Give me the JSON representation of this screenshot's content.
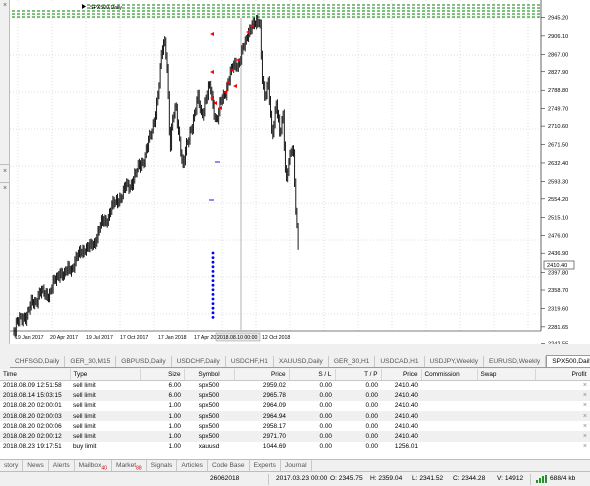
{
  "chart": {
    "symbol_label": "SPX500,Daily",
    "price_labels": [
      "2945.20",
      "2906.10",
      "2867.00",
      "2827.90",
      "2788.80",
      "2749.70",
      "2710.60",
      "2671.50",
      "2632.40",
      "2593.30",
      "2554.20",
      "2515.10",
      "2476.00",
      "2436.90",
      "2397.80",
      "2358.70",
      "2319.60",
      "2281.65",
      "2242.55"
    ],
    "current_price": "2410.40",
    "date_labels": [
      "19 Jan 2017",
      "20 Apr 2017",
      "19 Jul 2017",
      "17 Oct 2017",
      "17 Jan 2018",
      "17 Apr 2018",
      "2018.08.10 00:00",
      "12 Oct 2018"
    ],
    "colors": {
      "bar": "#000000",
      "grid": "#c0c0c0",
      "order_levels": "#008000",
      "sell_marker": "#ff0000",
      "buy_marker": "#0000ff"
    },
    "icons": [
      "close-icon",
      "arrow-icon"
    ]
  },
  "chart_tabs": [
    "CHFSGD,Daily",
    "GER_30,M15",
    "GBPUSD,Daily",
    "USDCHF,Daily",
    "USDCHF,H1",
    "XAUUSD,Daily",
    "GER_30,H1",
    "USDCAD,H1",
    "USDJPY,Weekly",
    "EURUSD,Weekly",
    "SPX500,Daily"
  ],
  "orders": {
    "headers": [
      "Time",
      "Type",
      "Size",
      "Symbol",
      "Price",
      "S / L",
      "T / P",
      "Price",
      "Commission",
      "Swap",
      "Profit"
    ],
    "rows": [
      [
        "2018.08.09 12:51:58",
        "sell limit",
        "6.00",
        "spx500",
        "2959.02",
        "0.00",
        "0.00",
        "2410.40",
        "",
        "",
        ""
      ],
      [
        "2018.08.14 15:03:15",
        "sell limit",
        "6.00",
        "spx500",
        "2965.78",
        "0.00",
        "0.00",
        "2410.40",
        "",
        "",
        ""
      ],
      [
        "2018.08.20 02:00:01",
        "sell limit",
        "1.00",
        "spx500",
        "2964.09",
        "0.00",
        "0.00",
        "2410.40",
        "",
        "",
        ""
      ],
      [
        "2018.08.20 02:00:03",
        "sell limit",
        "1.00",
        "spx500",
        "2964.94",
        "0.00",
        "0.00",
        "2410.40",
        "",
        "",
        ""
      ],
      [
        "2018.08.20 02:00:06",
        "sell limit",
        "1.00",
        "spx500",
        "2958.17",
        "0.00",
        "0.00",
        "2410.40",
        "",
        "",
        ""
      ],
      [
        "2018.08.20 02:00:12",
        "sell limit",
        "1.00",
        "spx500",
        "2971.70",
        "0.00",
        "0.00",
        "2410.40",
        "",
        "",
        ""
      ],
      [
        "2018.08.23 19:17:51",
        "buy limit",
        "1.00",
        "xauusd",
        "1044.69",
        "0.00",
        "0.00",
        "1256.01",
        "",
        "",
        ""
      ]
    ],
    "close_glyph": "×"
  },
  "terminal_tabs": [
    {
      "label": "story",
      "badge": ""
    },
    {
      "label": "News",
      "badge": ""
    },
    {
      "label": "Alerts",
      "badge": ""
    },
    {
      "label": "Mailbox",
      "badge": "40"
    },
    {
      "label": "Market",
      "badge": "88"
    },
    {
      "label": "Signals",
      "badge": ""
    },
    {
      "label": "Articles",
      "badge": ""
    },
    {
      "label": "Code Base",
      "badge": ""
    },
    {
      "label": "Experts",
      "badge": ""
    },
    {
      "label": "Journal",
      "badge": ""
    }
  ],
  "status": {
    "profile": "26062018",
    "datetime": "2017.03.23 00:00",
    "open": "O: 2345.75",
    "high": "H: 2359.04",
    "low": "L: 2341.52",
    "close": "C: 2344.28",
    "volume": "V: 14912",
    "traffic": "688/4 kb"
  }
}
